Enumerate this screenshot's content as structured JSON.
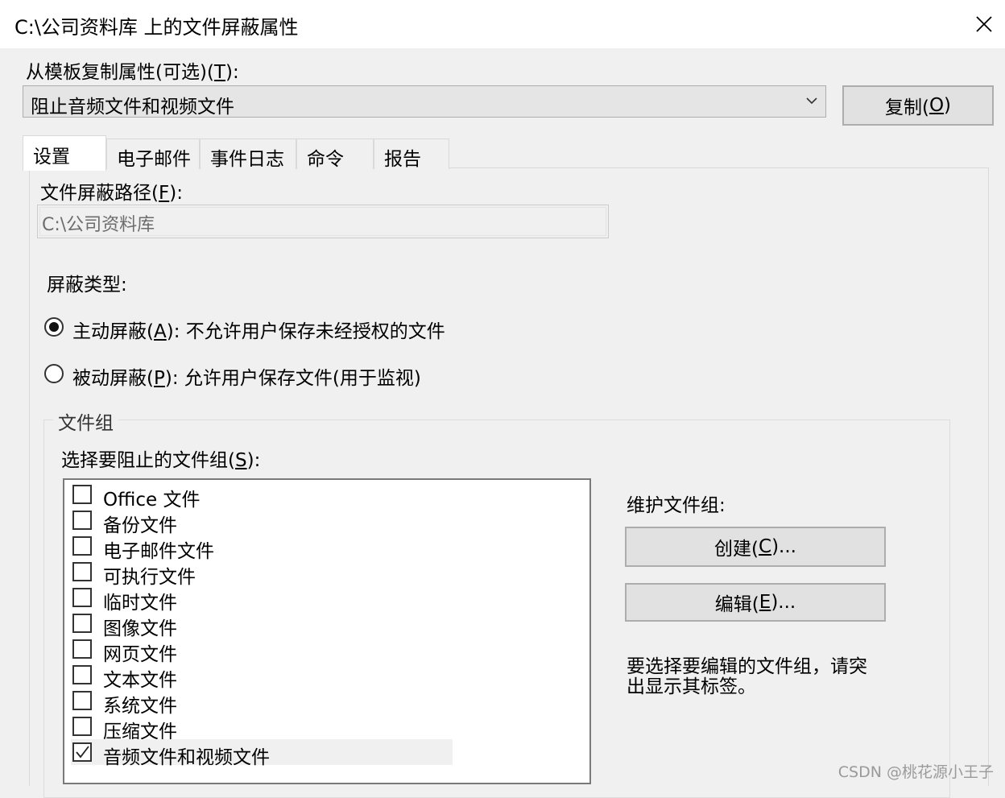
{
  "window": {
    "title": "C:\\公司资料库 上的文件屏蔽属性",
    "close_symbol": "✕"
  },
  "template": {
    "label": "从模板复制属性(可选)(",
    "label_key": "T",
    "label_end": "):",
    "selected": "阻止音频文件和视频文件",
    "copy_button": {
      "label": "复制(",
      "key": "O",
      "end": ")"
    }
  },
  "tabs": [
    {
      "label": "设置",
      "active": true
    },
    {
      "label": "电子邮件",
      "active": false
    },
    {
      "label": "事件日志",
      "active": false
    },
    {
      "label": "命令",
      "active": false
    },
    {
      "label": "报告",
      "active": false
    }
  ],
  "settings": {
    "path_label": "文件屏蔽路径(",
    "path_key": "F",
    "path_end": "):",
    "path_value": "C:\\公司资料库",
    "screening_type_label": "屏蔽类型:",
    "active_option": {
      "label": "主动屏蔽(",
      "key": "A",
      "desc": "): 不允许用户保存未经授权的文件",
      "checked": true
    },
    "passive_option": {
      "label": "被动屏蔽(",
      "key": "P",
      "desc": "): 允许用户保存文件(用于监视)",
      "checked": false
    }
  },
  "file_groups": {
    "group_title": "文件组",
    "select_label": "选择要阻止的文件组(",
    "select_key": "S",
    "select_end": "):",
    "items": [
      {
        "label": "Office 文件",
        "checked": false
      },
      {
        "label": "备份文件",
        "checked": false
      },
      {
        "label": "电子邮件文件",
        "checked": false
      },
      {
        "label": "可执行文件",
        "checked": false
      },
      {
        "label": "临时文件",
        "checked": false
      },
      {
        "label": "图像文件",
        "checked": false
      },
      {
        "label": "网页文件",
        "checked": false
      },
      {
        "label": "文本文件",
        "checked": false
      },
      {
        "label": "系统文件",
        "checked": false
      },
      {
        "label": "压缩文件",
        "checked": false
      },
      {
        "label": "音频文件和视频文件",
        "checked": true
      }
    ],
    "maintain_label": "维护文件组:",
    "create_button": {
      "label": "创建(",
      "key": "C",
      "end": ")..."
    },
    "edit_button": {
      "label": "编辑(",
      "key": "E",
      "end": ")..."
    },
    "hint_line1": "要选择要编辑的文件组，请突",
    "hint_line2": "出显示其标签。"
  },
  "watermark": "CSDN @桃花源小王子"
}
